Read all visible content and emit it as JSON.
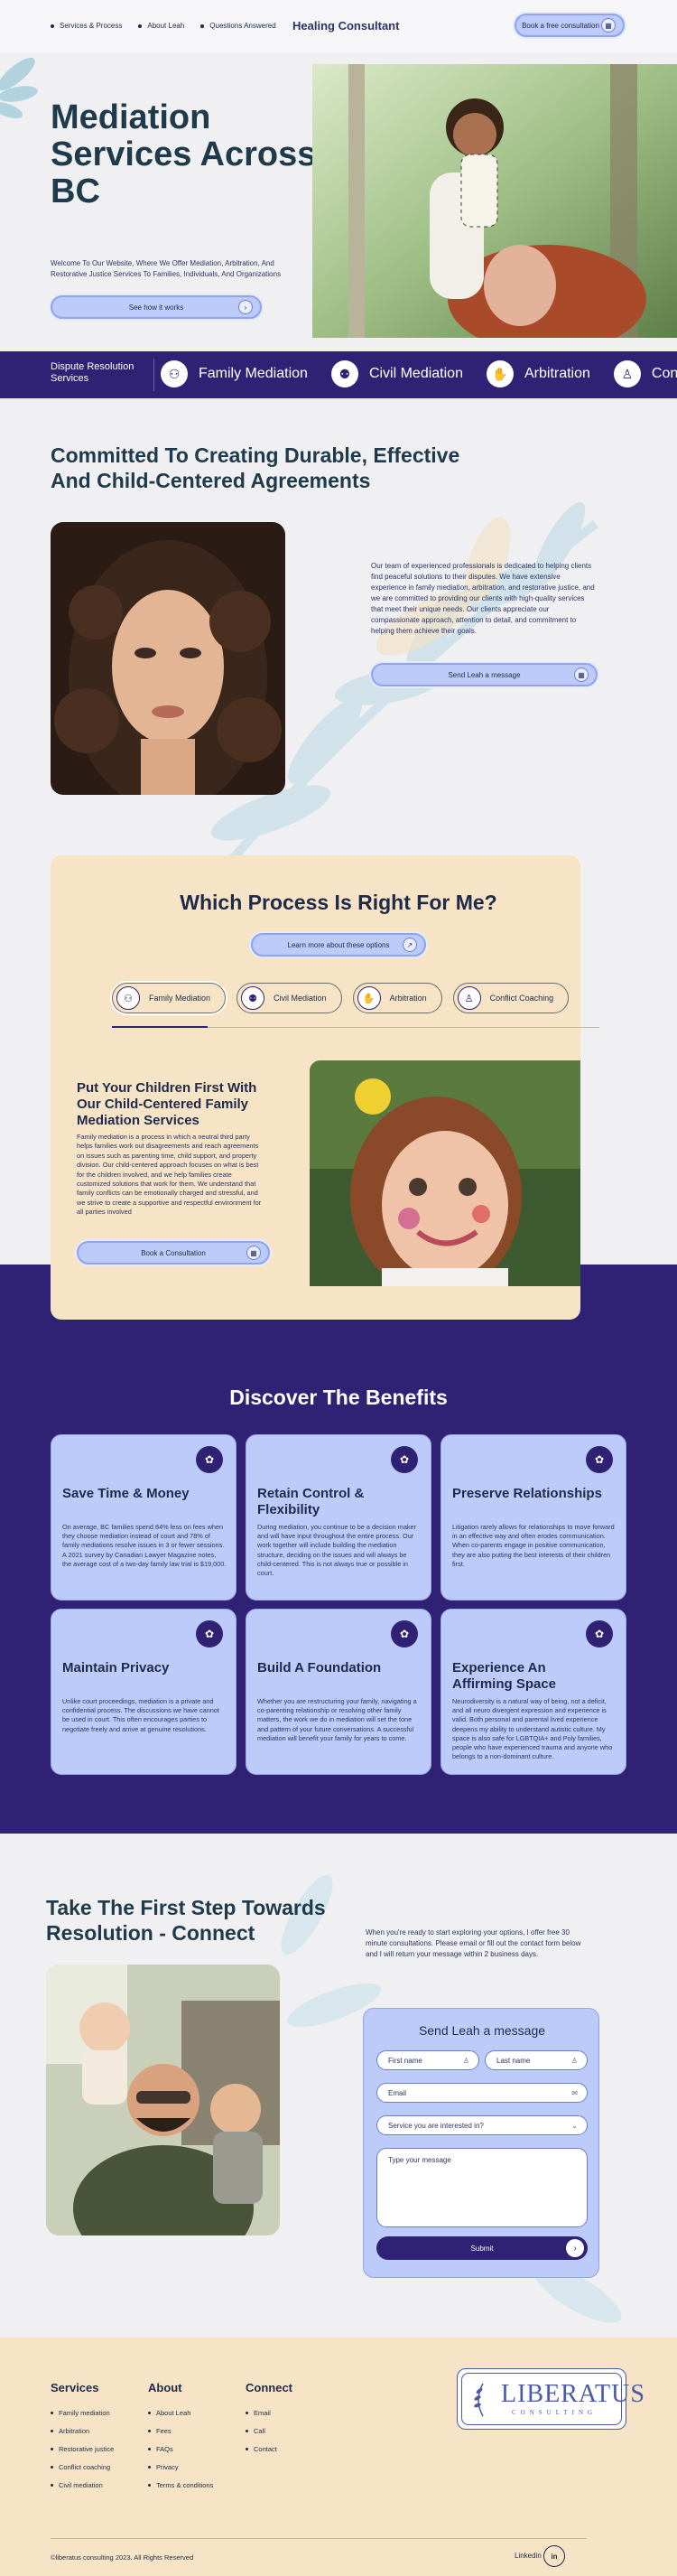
{
  "header": {
    "nav": [
      "Services & Process",
      "About Leah",
      "Questions Answered"
    ],
    "brand": "Healing Consultant",
    "cta": "Book a free consultation"
  },
  "hero": {
    "title": "Mediation Services Across BC",
    "subtitle": "Welcome To Our Website, Where We Offer Mediation, Arbitration, And Restorative Justice Services To Families, Individuals, And Organizations",
    "cta": "See how it works"
  },
  "band": {
    "label": "Dispute Resolution Services",
    "items": [
      "Family Mediation",
      "Civil Mediation",
      "Arbitration",
      "Conflict Coaching"
    ]
  },
  "commitment": {
    "title": "Committed To Creating Durable, Effective And Child-Centered Agreements",
    "body": "Our team of experienced professionals is dedicated to helping clients find peaceful solutions to their disputes. We have extensive experience in family mediation, arbitration, and restorative justice, and we are committed to providing our clients with high-quality services that meet their unique needs. Our clients appreciate our compassionate approach, attention to detail, and commitment to helping them achieve their goals.",
    "cta": "Send Leah a message"
  },
  "process": {
    "title": "Which Process Is Right For Me?",
    "learn": "Learn more about these options",
    "tabs": [
      "Family Mediation",
      "Civil Mediation",
      "Arbitration",
      "Conflict Coaching"
    ],
    "heading": "Put Your Children First With Our Child-Centered Family Mediation Services",
    "body": "Family mediation is a process in which a neutral third party helps families work out disagreements and reach agreements on issues such as parenting time, child support, and property division. Our child-centered approach focuses on what is best for the children involved, and we help families create customized solutions that work for them. We understand that family conflicts can be emotionally charged and stressful, and we strive to create a supportive and respectful environment for all parties involved",
    "cta": "Book a Consultation"
  },
  "benefits": {
    "title": "Discover The Benefits",
    "cards": [
      {
        "title": "Save Time & Money",
        "body": "On average, BC families spend 84% less on fees when they choose mediation instead of court and 78% of family mediations resolve issues in 3 or fewer sessions. A 2021 survey by Canadian Lawyer Magazine notes, the average cost of a two-day family law trial is $19,000."
      },
      {
        "title": "Retain Control & Flexibility",
        "body": "During mediation, you continue to be a decision maker and will have input throughout the entire process. Our work together will include building the mediation structure, deciding on the issues and will always be child-centered. This is not always true or possible in court."
      },
      {
        "title": "Preserve Relationships",
        "body": "Litigation rarely allows for relationships to move forward in an effective way and often erodes communication. When co-parents engage in positive communication, they are also putting the best interests of their children first."
      },
      {
        "title": "Maintain Privacy",
        "body": "Unlike court proceedings, mediation is a private and confidential process. The discussions we have cannot be used in court. This often encourages parties to negotiate freely and arrive at genuine resolutions."
      },
      {
        "title": "Build A Foundation",
        "body": "Whether you are restructuring your family, navigating a co-parenting relationship or resolving other family matters, the work we do in mediation will set the tone and pattern of your future conversations. A successful mediation will benefit your family for years to come."
      },
      {
        "title": "Experience An Affirming Space",
        "body": "Neurodiversity is a natural way of being, not a deficit, and all neuro divergent expression and experience is valid. Both personal and parental lived experience deepens my ability to understand autistic culture. My space is also safe for LGBTQIA+ and Poly families, people who have experienced trauma and anyone who belongs to a non-dominant culture."
      }
    ]
  },
  "connect": {
    "title": "Take The First Step Towards Resolution - Connect",
    "body": "When you're ready to start exploring your options, I offer free 30 minute consultations. Please email or fill out the contact form below and I will return your message within 2 business days.",
    "form": {
      "title": "Send Leah a message",
      "first": "First name",
      "last": "Last name",
      "email": "Email",
      "service": "Service you are interested in?",
      "message": "Type your message",
      "submit": "Submit"
    }
  },
  "footer": {
    "services_h": "Services",
    "services": [
      "Family mediation",
      "Arbitration",
      "Restorative justice",
      "Conflict coaching",
      "Civil mediation"
    ],
    "about_h": "About",
    "about": [
      "About Leah",
      "Fees",
      "FAQs",
      "Privacy",
      "Terms & conditions"
    ],
    "connect_h": "Connect",
    "connect": [
      "Email",
      "Call",
      "Contact"
    ],
    "logo_main": "LIBERATUS",
    "logo_sub": "CONSULTING",
    "copyright": "©liberatus consulting  2023. All Rights Reserved",
    "linkedin": "Linkedin",
    "linkedin_icon": "in"
  },
  "colors": {
    "purple": "#2f2173",
    "lavender": "#bccbfa",
    "peach": "#f7e4c6",
    "navy": "#1f2a4a"
  }
}
